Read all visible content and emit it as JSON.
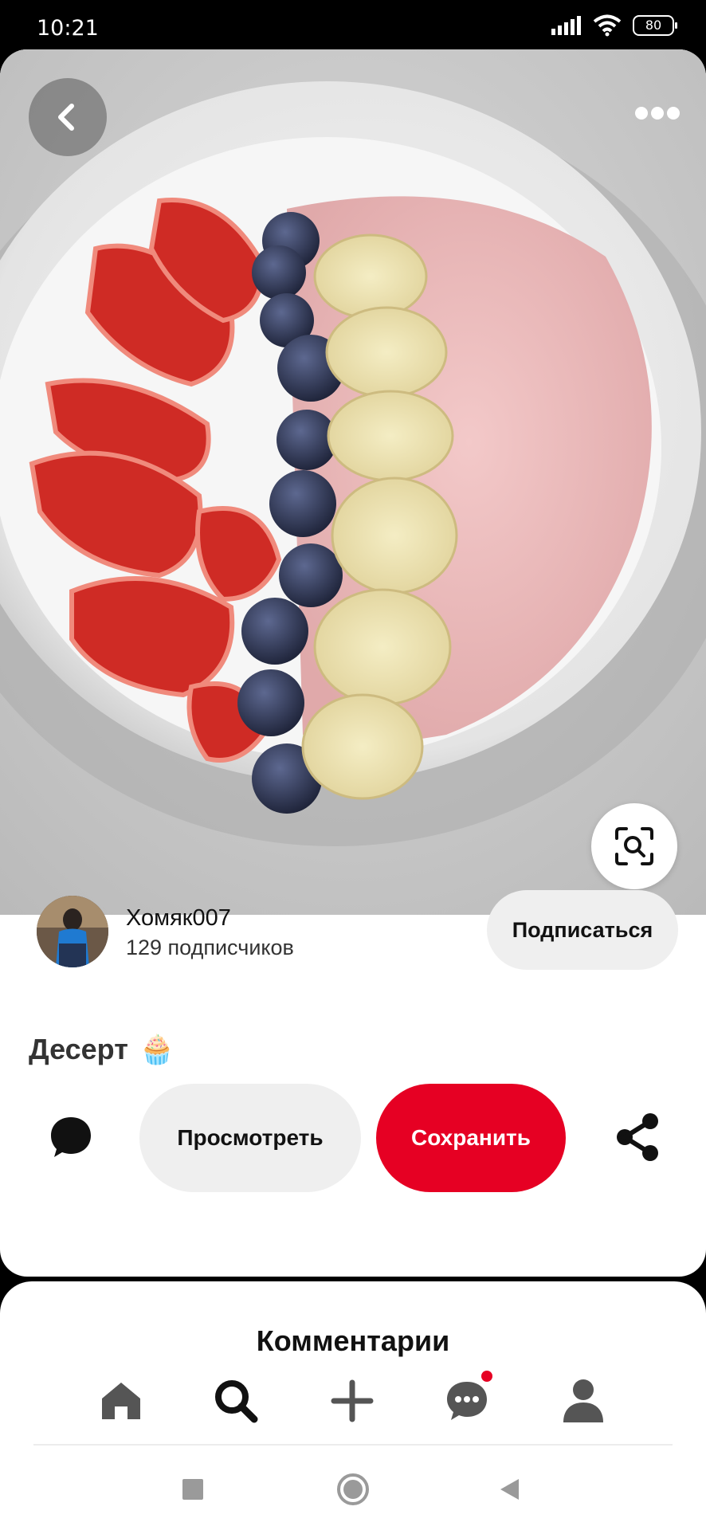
{
  "status_bar": {
    "time": "10:21",
    "battery": "80"
  },
  "pin": {
    "image_alt": "Смузи-боул с клубникой, голубикой и бананом",
    "creator": {
      "name": "Хомяк007",
      "followers": "129 подписчиков"
    },
    "follow_label": "Подписаться",
    "title": "Десерт",
    "title_emoji": "🧁",
    "view_label": "Просмотреть",
    "save_label": "Сохранить"
  },
  "comments": {
    "title": "Комментарии"
  },
  "bottom_nav": {
    "items": [
      "home-icon",
      "search-icon",
      "plus-icon",
      "messages-icon",
      "profile-icon"
    ],
    "has_notification": true
  },
  "colors": {
    "accent": "#e60023",
    "secondary_button": "#efefef",
    "icon": "#111111"
  }
}
